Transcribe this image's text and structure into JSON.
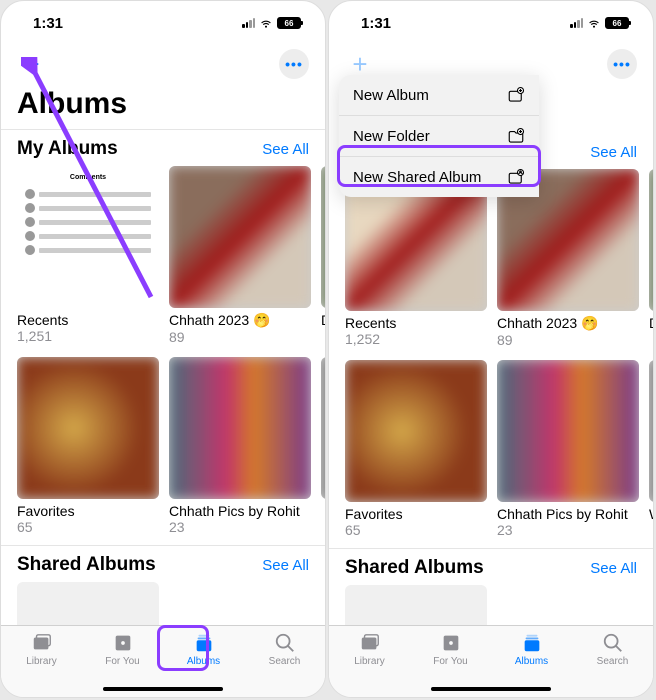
{
  "status": {
    "time": "1:31",
    "battery": "66"
  },
  "toolbar": {
    "more_dots": "•••"
  },
  "page": {
    "title": "Albums"
  },
  "sections": {
    "my_albums": {
      "title": "My Albums",
      "see_all": "See All"
    },
    "shared": {
      "title": "Shared Albums",
      "see_all": "See All"
    }
  },
  "albums_row1": [
    {
      "title": "Recents",
      "count": "1,251"
    },
    {
      "title": "Chhath 2023 🤭",
      "count": "89"
    },
    {
      "title": "D",
      "count": ""
    }
  ],
  "albums_row1_b": [
    {
      "title": "Recents",
      "count": "1,252"
    },
    {
      "title": "Chhath 2023 🤭",
      "count": "89"
    },
    {
      "title": "D",
      "count": ""
    }
  ],
  "albums_row2": [
    {
      "title": "Favorites",
      "count": "65"
    },
    {
      "title": "Chhath Pics by Rohit",
      "count": "23"
    },
    {
      "title": "W",
      "count": ""
    }
  ],
  "tabs": [
    {
      "label": "Library"
    },
    {
      "label": "For You"
    },
    {
      "label": "Albums"
    },
    {
      "label": "Search"
    }
  ],
  "menu": [
    {
      "label": "New Album",
      "icon": "rect"
    },
    {
      "label": "New Folder",
      "icon": "folder"
    },
    {
      "label": "New Shared Album",
      "icon": "rect"
    }
  ],
  "colors": {
    "accent": "#007aff",
    "highlight": "#8b3dff"
  }
}
